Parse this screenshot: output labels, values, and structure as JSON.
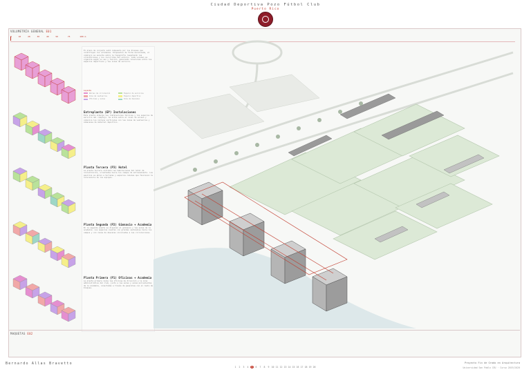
{
  "header": {
    "title": "Ciudad Deportiva Pozo Fútbol Club",
    "subtitle": "Puerto Rico"
  },
  "sections": {
    "top_label": "VOLUMETRÍA GENERAL",
    "top_tag": "E01",
    "bottom_label": "MAQUETAS",
    "bottom_tag": "E02"
  },
  "scale_numbers": [
    "0",
    "10",
    "20",
    "30",
    "40",
    "50",
    "75",
    "100 m"
  ],
  "panel": {
    "intro": "El plano de conjunto está compuesto por los bloques que constituyen los volúmenes. Dispuestos de forma escalonada, el complejo se asienta sobre la topografía respetando las orientaciones y los recorridos del entorno. Cada volumen se organiza según su uso y función, generando relaciones entre los espacios deportivos y las zonas de servicio.",
    "blocks": [
      {
        "title": "Entreplanta (EP) Instalaciones",
        "text": "Esta planta alberga las instalaciones técnicas y los espacios de servicio del complejo. Se sitúa sobre el nivel de acceso y comunica los núcleos verticales con las zonas de vestuarios y almacenes de material deportivo."
      },
      {
        "title": "Planta Tercera (P3) Hotel",
        "text": "La planta tercera contiene las habitaciones del hotel de concentración, orientadas hacia los campos de entrenamiento. Los pasillos se abren a terrazas y espacios comunes que favorecen la convivencia de los equipos."
      },
      {
        "title": "Planta Segunda (P2) Gimnasio + Academia",
        "text": "En la segunda planta se disponen el gimnasio y las aulas de la academia. Los espacios cuentan con grandes ventanales hacia los campos y con zonas de descanso vinculadas a las circulaciones."
      },
      {
        "title": "Planta Primera (P1) Oficinas + Academia",
        "text": "La planta primera reúne las oficinas de dirección y la zona administrativa del club, junto a las aulas y salas polivalentes de la academia, conectadas a través de pasarelas con el resto de bloques."
      }
    ],
    "legend_label": "Leyenda",
    "legend": [
      {
        "label": "Núcleo de circulación",
        "color": "#e58fd0"
      },
      {
        "label": "Espacio de servicios",
        "color": "#b9e29a"
      },
      {
        "label": "Zona de vestuarios",
        "color": "#f1a8a8"
      },
      {
        "label": "Espacio deportivo",
        "color": "#f5ef8a"
      },
      {
        "label": "Oficinas y salas",
        "color": "#c7a3e8"
      },
      {
        "label": "Zona de descanso",
        "color": "#9ed7c6"
      }
    ]
  },
  "footer": {
    "author": "Bernardo Allas Bravetto",
    "pages": [
      "1",
      "2",
      "3",
      "4",
      "5",
      "6",
      "7",
      "8",
      "9",
      "10",
      "11",
      "12",
      "13",
      "14",
      "15",
      "16",
      "17",
      "18",
      "19",
      "20"
    ],
    "active_page": "5",
    "project": "Proyecto Fin de Grado en Arquitectura",
    "university": "Universidad San Pablo CEU · Curso 2019/2020"
  }
}
